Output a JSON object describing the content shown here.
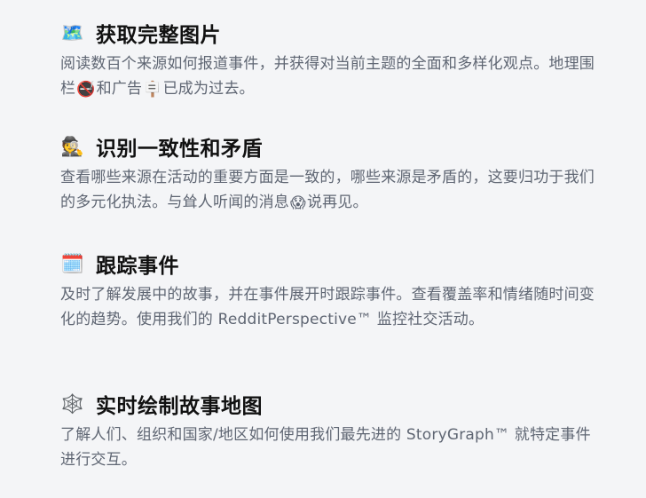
{
  "features": [
    {
      "icon": "🗺️",
      "icon_name": "map-icon",
      "title": "获取完整图片",
      "desc_parts": [
        "阅读数百个来源如何报道事件，并获得对当前主题的全面和多样化观点。地理围栏",
        "和广告",
        "已成为过去。"
      ],
      "inline_icons": [
        {
          "glyph": "🚭",
          "name": "no-entry-icon"
        },
        {
          "glyph": "🪧",
          "name": "placard-icon"
        }
      ]
    },
    {
      "icon": "🕵️",
      "icon_name": "detective-icon",
      "title": "识别一致性和矛盾",
      "desc_parts": [
        "查看哪些来源在活动的重要方面是一致的，哪些来源是矛盾的，这要归功于我们的多元化执法。与耸人听闻的消息",
        "说再见。"
      ],
      "inline_icons": [
        {
          "glyph": "😱",
          "name": "screaming-face-icon"
        }
      ]
    },
    {
      "icon": "🗓️",
      "icon_name": "calendar-icon",
      "title": "跟踪事件",
      "desc": "及时了解发展中的故事，并在事件展开时跟踪事件。查看覆盖率和情绪随时间变化的趋势。使用我们的 RedditPerspective™ 监控社交活动。"
    },
    {
      "icon": "🕸️",
      "icon_name": "spider-web-icon",
      "title": "实时绘制故事地图",
      "desc": "了解人们、组织和国家/地区如何使用我们最先进的 StoryGraph™ 就特定事件进行交互。"
    }
  ]
}
